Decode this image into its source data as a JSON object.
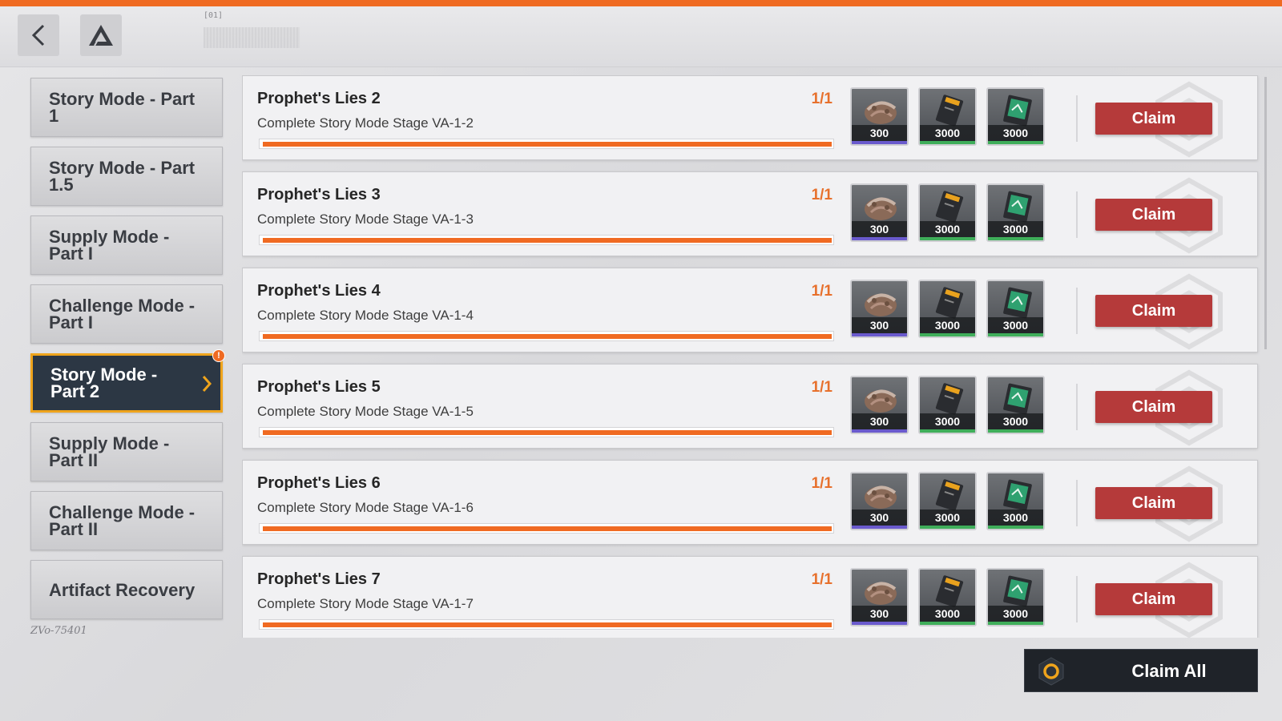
{
  "header": {
    "back_icon": "chevron-left-icon",
    "home_icon": "triangle-logo-icon",
    "tag": "[01]"
  },
  "sidebar": {
    "items": [
      {
        "label": "Story Mode - Part 1",
        "active": false
      },
      {
        "label": "Story Mode - Part 1.5",
        "active": false
      },
      {
        "label": "Supply Mode - Part I",
        "active": false
      },
      {
        "label": "Challenge Mode - Part I",
        "active": false
      },
      {
        "label": "Story Mode - Part 2",
        "active": true,
        "alert": "!"
      },
      {
        "label": "Supply Mode - Part II",
        "active": false
      },
      {
        "label": "Challenge Mode - Part II",
        "active": false
      },
      {
        "label": "Artifact Recovery",
        "active": false
      }
    ],
    "signature": "ZVo-75401"
  },
  "missions": [
    {
      "title": "Prophet's Lies 2",
      "description": "Complete Story Mode Stage VA-1-2",
      "progress_text": "1/1",
      "progress": 1.0,
      "rewards": [
        {
          "icon": "supply-pack-icon",
          "qty": "300",
          "rarity_color": "#6a5acd"
        },
        {
          "icon": "yellow-data-chip-icon",
          "qty": "3000",
          "rarity_color": "#3fae5a"
        },
        {
          "icon": "green-data-chip-icon",
          "qty": "3000",
          "rarity_color": "#3fae5a"
        }
      ],
      "claim_label": "Claim"
    },
    {
      "title": "Prophet's Lies 3",
      "description": "Complete Story Mode Stage VA-1-3",
      "progress_text": "1/1",
      "progress": 1.0,
      "rewards": [
        {
          "icon": "supply-pack-icon",
          "qty": "300",
          "rarity_color": "#6a5acd"
        },
        {
          "icon": "yellow-data-chip-icon",
          "qty": "3000",
          "rarity_color": "#3fae5a"
        },
        {
          "icon": "green-data-chip-icon",
          "qty": "3000",
          "rarity_color": "#3fae5a"
        }
      ],
      "claim_label": "Claim"
    },
    {
      "title": "Prophet's Lies 4",
      "description": "Complete Story Mode Stage VA-1-4",
      "progress_text": "1/1",
      "progress": 1.0,
      "rewards": [
        {
          "icon": "supply-pack-icon",
          "qty": "300",
          "rarity_color": "#6a5acd"
        },
        {
          "icon": "yellow-data-chip-icon",
          "qty": "3000",
          "rarity_color": "#3fae5a"
        },
        {
          "icon": "green-data-chip-icon",
          "qty": "3000",
          "rarity_color": "#3fae5a"
        }
      ],
      "claim_label": "Claim"
    },
    {
      "title": "Prophet's Lies 5",
      "description": "Complete Story Mode Stage VA-1-5",
      "progress_text": "1/1",
      "progress": 1.0,
      "rewards": [
        {
          "icon": "supply-pack-icon",
          "qty": "300",
          "rarity_color": "#6a5acd"
        },
        {
          "icon": "yellow-data-chip-icon",
          "qty": "3000",
          "rarity_color": "#3fae5a"
        },
        {
          "icon": "green-data-chip-icon",
          "qty": "3000",
          "rarity_color": "#3fae5a"
        }
      ],
      "claim_label": "Claim"
    },
    {
      "title": "Prophet's Lies 6",
      "description": "Complete Story Mode Stage VA-1-6",
      "progress_text": "1/1",
      "progress": 1.0,
      "rewards": [
        {
          "icon": "supply-pack-icon",
          "qty": "300",
          "rarity_color": "#6a5acd"
        },
        {
          "icon": "yellow-data-chip-icon",
          "qty": "3000",
          "rarity_color": "#3fae5a"
        },
        {
          "icon": "green-data-chip-icon",
          "qty": "3000",
          "rarity_color": "#3fae5a"
        }
      ],
      "claim_label": "Claim"
    },
    {
      "title": "Prophet's Lies 7",
      "description": "Complete Story Mode Stage VA-1-7",
      "progress_text": "1/1",
      "progress": 1.0,
      "rewards": [
        {
          "icon": "supply-pack-icon",
          "qty": "300",
          "rarity_color": "#6a5acd"
        },
        {
          "icon": "yellow-data-chip-icon",
          "qty": "3000",
          "rarity_color": "#3fae5a"
        },
        {
          "icon": "green-data-chip-icon",
          "qty": "3000",
          "rarity_color": "#3fae5a"
        }
      ],
      "claim_label": "Claim"
    }
  ],
  "claim_all": {
    "label": "Claim All",
    "icon": "hexagon-ring-icon"
  },
  "colors": {
    "accent_orange": "#ef6a22",
    "claim_red": "#b53a3a",
    "active_tab_bg": "#2c3744",
    "active_tab_border": "#efa41c"
  }
}
